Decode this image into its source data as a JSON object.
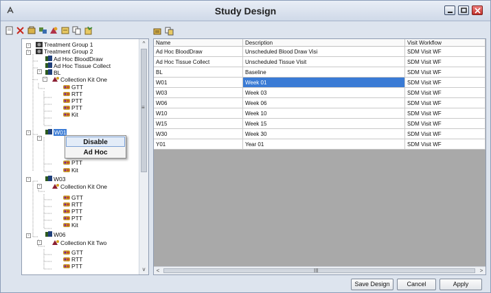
{
  "window": {
    "title": "Study Design"
  },
  "tree": {
    "nodes": [
      {
        "label": "Treatment Group 1",
        "icon": "group-icon"
      },
      {
        "label": "Treatment Group 2",
        "icon": "group-icon"
      },
      {
        "label": "Ad Hoc BloodDraw",
        "icon": "visit-icon"
      },
      {
        "label": "Ad Hoc Tissue Collect",
        "icon": "visit-icon"
      },
      {
        "label": "BL",
        "icon": "visit-icon"
      },
      {
        "label": "Collection Kit One",
        "icon": "kit-icon"
      },
      {
        "label": "GTT",
        "icon": "tube-icon"
      },
      {
        "label": "RTT",
        "icon": "tube-icon"
      },
      {
        "label": "PTT",
        "icon": "tube-icon"
      },
      {
        "label": "PTT",
        "icon": "tube-icon"
      },
      {
        "label": "Kit",
        "icon": "tube-icon"
      },
      {
        "label": "W01",
        "icon": "visit-icon",
        "selected": true
      },
      {
        "label": "PTT",
        "icon": "tube-icon"
      },
      {
        "label": "Kit",
        "icon": "tube-icon"
      },
      {
        "label": "W03",
        "icon": "visit-icon"
      },
      {
        "label": "Collection Kit One",
        "icon": "kit-icon"
      },
      {
        "label": "GTT",
        "icon": "tube-icon"
      },
      {
        "label": "RTT",
        "icon": "tube-icon"
      },
      {
        "label": "PTT",
        "icon": "tube-icon"
      },
      {
        "label": "PTT",
        "icon": "tube-icon"
      },
      {
        "label": "Kit",
        "icon": "tube-icon"
      },
      {
        "label": "W06",
        "icon": "visit-icon"
      },
      {
        "label": "Collection Kit Two",
        "icon": "kit-icon"
      },
      {
        "label": "GTT",
        "icon": "tube-icon"
      },
      {
        "label": "RTT",
        "icon": "tube-icon"
      },
      {
        "label": "PTT",
        "icon": "tube-icon"
      }
    ]
  },
  "context_menu": {
    "items": [
      "Disable",
      "Ad Hoc"
    ]
  },
  "grid": {
    "columns": [
      "Name",
      "Description",
      "Visit Workflow"
    ],
    "rows": [
      [
        "Ad Hoc BloodDraw",
        "Unscheduled Blood Draw Visi",
        "SDM Visit WF"
      ],
      [
        "Ad Hoc Tissue Collect",
        "Unscheduled Tissue Visit",
        "SDM Visit WF"
      ],
      [
        "BL",
        "Baseline",
        "SDM Visit WF"
      ],
      [
        "W01",
        "Week 01",
        "SDM Visit WF"
      ],
      [
        "W03",
        "Week 03",
        "SDM Visit WF"
      ],
      [
        "W06",
        "Week 06",
        "SDM Visit WF"
      ],
      [
        "W10",
        "Week 10",
        "SDM Visit WF"
      ],
      [
        "W15",
        "Week 15",
        "SDM Visit WF"
      ],
      [
        "W30",
        "Week 30",
        "SDM Visit WF"
      ],
      [
        "Y01",
        "Year 01",
        "SDM Visit WF"
      ]
    ],
    "selected_cell": "Week 01"
  },
  "buttons": {
    "save": "Save Design",
    "cancel": "Cancel",
    "apply": "Apply"
  },
  "scroll_glyphs": {
    "up": "^",
    "down": "v",
    "left": "<",
    "right": ">",
    "grip": "III",
    "vgrip": "≡"
  },
  "colors": {
    "selection": "#3a7bd5",
    "grid_background": "#a9a9a9"
  }
}
